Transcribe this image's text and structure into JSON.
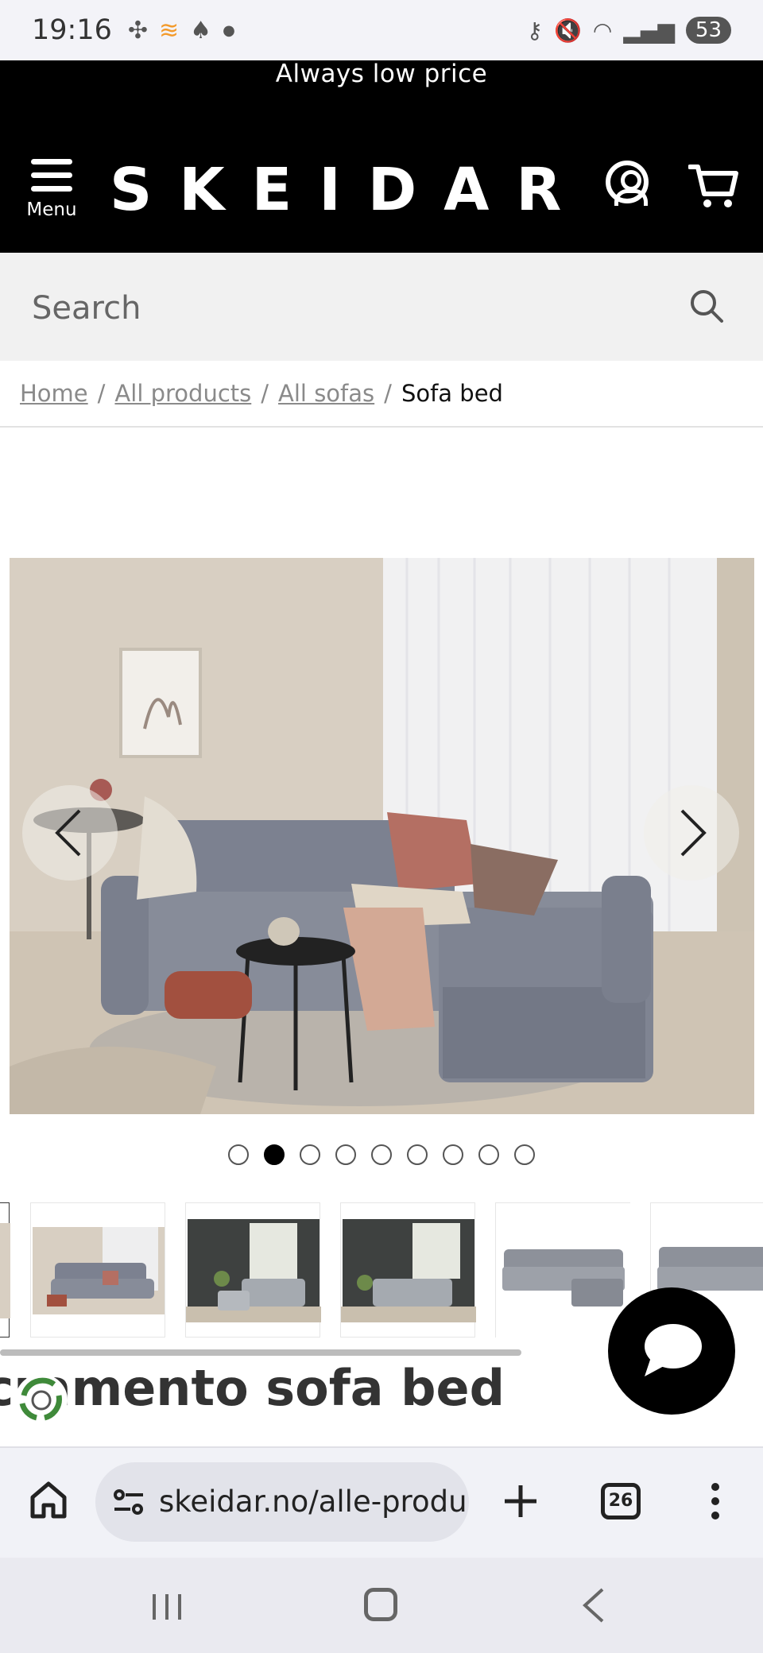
{
  "status_bar": {
    "time": "19:16",
    "battery": "53",
    "left_icons": [
      "pinwheel-icon",
      "app-icon",
      "snapchat-icon",
      "dot-icon"
    ],
    "right_icons": [
      "key-icon",
      "mute-icon",
      "wifi-icon",
      "signal-icon",
      "battery-icon"
    ]
  },
  "promo": {
    "text": "Always low price"
  },
  "header": {
    "menu_label": "Menu",
    "logo": "SKEIDAR",
    "account_icon": "account-icon",
    "cart_icon": "cart-icon"
  },
  "search": {
    "placeholder": "Search"
  },
  "breadcrumb": {
    "items": [
      "Home",
      "All products",
      "All sofas"
    ],
    "current": "Sofa bed"
  },
  "gallery": {
    "total_slides": 9,
    "active_slide": 2
  },
  "product": {
    "title": "Sacramento sofa bed"
  },
  "browser": {
    "url": "skeidar.no/alle-produ",
    "tab_count": "26"
  },
  "colors": {
    "brand_black": "#000000",
    "sofa_grey": "#7c8190",
    "cushion_pink": "#b46f63"
  }
}
